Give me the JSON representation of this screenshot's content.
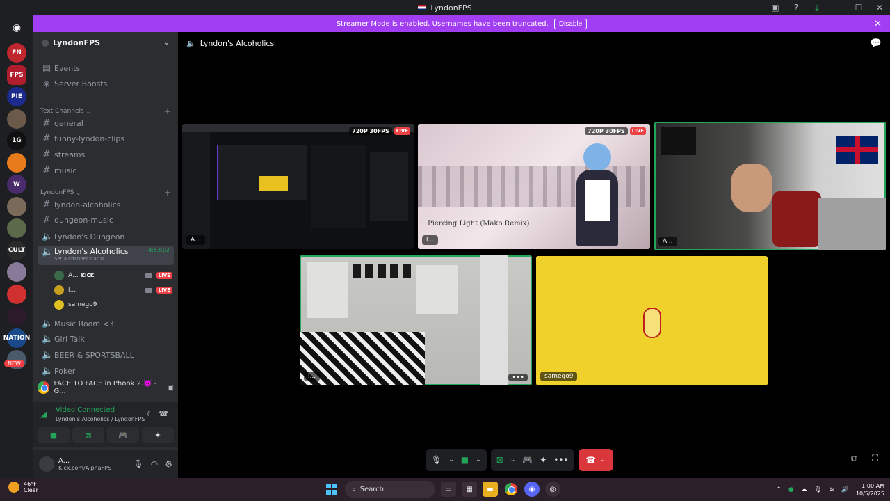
{
  "window": {
    "title": "LyndonFPS",
    "controls": [
      "inbox-icon",
      "help-icon",
      "download-icon",
      "minimize",
      "maximize",
      "close"
    ]
  },
  "banner": {
    "text": "Streamer Mode is enabled. Usernames have been truncated.",
    "disable_label": "Disable"
  },
  "servers": [
    {
      "label": "FN",
      "color": "#c0262d"
    },
    {
      "label": "FPS",
      "color": "#b01e2e"
    },
    {
      "label": "PIE",
      "color": "#1b2a8c"
    },
    {
      "label": "",
      "color": "#6b5a4a"
    },
    {
      "label": "1G",
      "color": "#101010"
    },
    {
      "label": "",
      "color": "#e87b1c"
    },
    {
      "label": "W",
      "color": "#4a2b6b"
    },
    {
      "label": "",
      "color": "#7a6a5a"
    },
    {
      "label": "",
      "color": "#5a6a4a"
    },
    {
      "label": "CULT",
      "color": "#2a2a2a"
    },
    {
      "label": "",
      "color": "#8a7a9a"
    },
    {
      "label": "",
      "color": "#d03030"
    },
    {
      "label": "",
      "color": "#2a1a2a"
    },
    {
      "label": "NATION",
      "color": "#1a4a8a"
    },
    {
      "label": "",
      "color": "#4a5a6a"
    }
  ],
  "sidebar": {
    "guild_name": "LyndonFPS",
    "top_items": [
      {
        "label": "Events"
      },
      {
        "label": "Server Boosts"
      }
    ],
    "text_category": "Text Channels",
    "text_channels": [
      "general",
      "funny-lyndon-clips",
      "streams",
      "music"
    ],
    "lyndon_category": "LyndonFPS",
    "lyndon_channels": [
      "lyndon-alcoholics",
      "dungeon-music"
    ],
    "voice_channels_before": [
      "Lyndon's Dungeon"
    ],
    "active_voice": {
      "name": "Lyndon's Alcoholics",
      "timer": "4:53:02",
      "status": "Set a channel status"
    },
    "voice_users": [
      {
        "name": "A...",
        "tag": "KICK",
        "live": "LIVE",
        "color": "#3a6a4a"
      },
      {
        "name": "l...",
        "tag": "",
        "live": "LIVE",
        "color": "#c8a020"
      },
      {
        "name": "samego9",
        "tag": "",
        "live": "",
        "color": "#e0c020"
      }
    ],
    "voice_channels_after": [
      "Music Room <3",
      "Girl Talk",
      "BEER & SPORTSBALL",
      "Poker"
    ],
    "activity": "FACE TO FACE in Phonk 2.👿   - G...",
    "rtc_status": "Video Connected",
    "rtc_sub": "Lyndon's Alcoholics / LyndonFPS",
    "new_badge": "NEW"
  },
  "user_panel": {
    "name": "A...",
    "status": "Kick.com/AlphaFPS"
  },
  "stage": {
    "channel": "Lyndon's Alcoholics",
    "tiles": [
      {
        "label": "A...",
        "quality": "720P 30FPS",
        "live": "LIVE"
      },
      {
        "label": "l...",
        "quality": "720P 30FPS",
        "live": "LIVE",
        "caption": "Piercing Light (Mako Remix)"
      },
      {
        "label": "A..."
      },
      {
        "label": "l..."
      },
      {
        "label": "samego9"
      }
    ]
  },
  "taskbar": {
    "weather_temp": "46°F",
    "weather_desc": "Clear",
    "search_placeholder": "Search",
    "time": "1:00 AM",
    "date": "10/5/2025"
  },
  "colors": {
    "banner": "#a13ef2",
    "speaking": "#23a55a",
    "live": "#ed4245",
    "end_call": "#da373c",
    "yellow_tile": "#f0d12b"
  }
}
